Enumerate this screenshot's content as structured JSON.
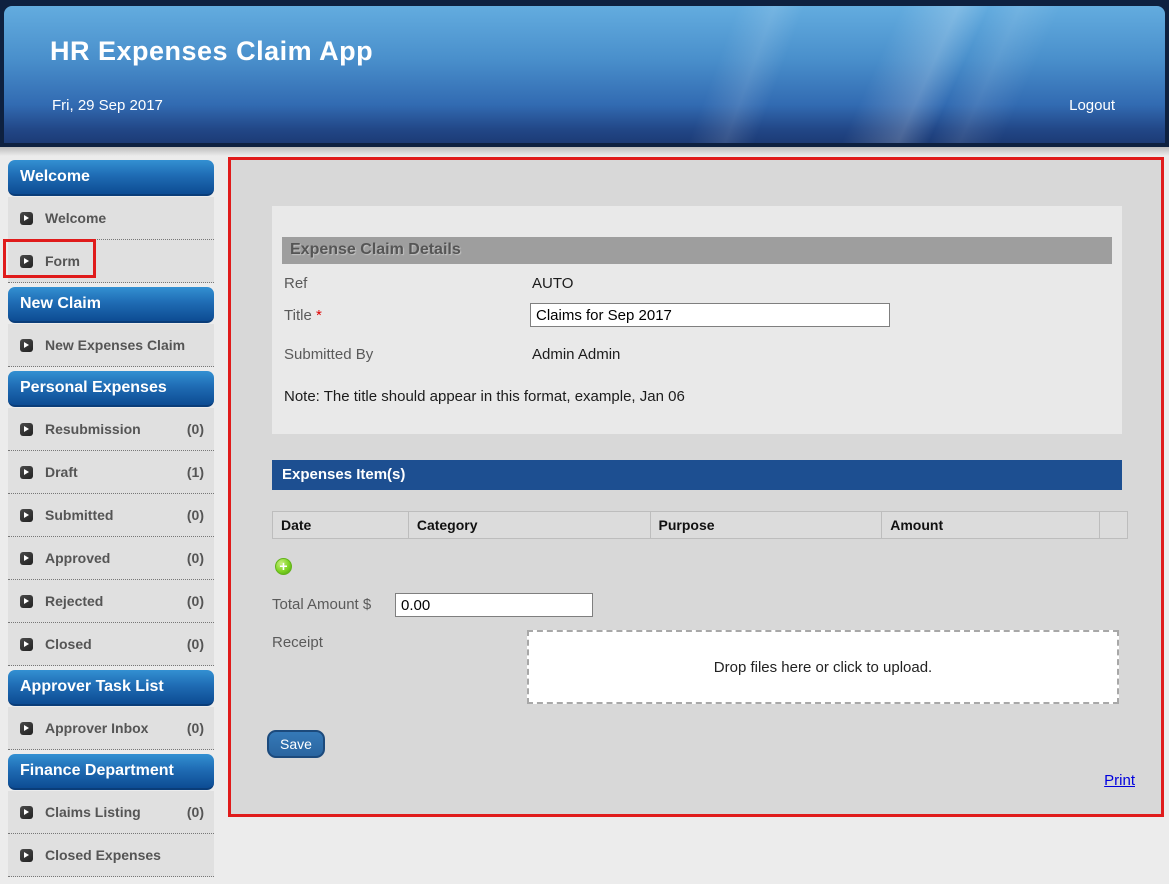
{
  "header": {
    "title": "HR Expenses Claim App",
    "date": "Fri, 29 Sep 2017",
    "logout_label": "Logout"
  },
  "sidebar": {
    "sections": [
      {
        "header": "Welcome",
        "items": [
          {
            "label": "Welcome",
            "count": ""
          },
          {
            "label": "Form",
            "count": "",
            "highlighted": true
          }
        ]
      },
      {
        "header": "New Claim",
        "items": [
          {
            "label": "New Expenses Claim",
            "count": ""
          }
        ]
      },
      {
        "header": "Personal Expenses",
        "items": [
          {
            "label": "Resubmission",
            "count": "(0)"
          },
          {
            "label": "Draft",
            "count": "(1)"
          },
          {
            "label": "Submitted",
            "count": "(0)"
          },
          {
            "label": "Approved",
            "count": "(0)"
          },
          {
            "label": "Rejected",
            "count": "(0)"
          },
          {
            "label": "Closed",
            "count": "(0)"
          }
        ]
      },
      {
        "header": "Approver Task List",
        "items": [
          {
            "label": "Approver Inbox",
            "count": "(0)"
          }
        ]
      },
      {
        "header": "Finance Department",
        "items": [
          {
            "label": "Claims Listing",
            "count": "(0)"
          },
          {
            "label": "Closed Expenses",
            "count": ""
          }
        ]
      }
    ]
  },
  "main": {
    "details": {
      "header": "Expense Claim Details",
      "ref_label": "Ref",
      "ref_value": "AUTO",
      "title_label": "Title",
      "required_marker": "*",
      "title_value": "Claims for Sep 2017",
      "submitted_by_label": "Submitted By",
      "submitted_by_value": "Admin Admin",
      "note": "Note: The title should appear in this format, example, Jan 06"
    },
    "items": {
      "header": "Expenses Item(s)",
      "columns": [
        "Date",
        "Category",
        "Purpose",
        "Amount"
      ],
      "add_icon": "plus-circle-icon",
      "add_glyph": "+",
      "total_label": "Total Amount $",
      "total_value": "0.00",
      "receipt_label": "Receipt",
      "dropzone_text": "Drop files here or click to upload."
    },
    "save_label": "Save",
    "print_label": "Print"
  },
  "colors": {
    "banner_navy": "#0e2140",
    "section_header_blue": "#0d4c93",
    "items_bar_blue": "#1d4f91",
    "annotation_red": "#e01b1b",
    "add_green": "#7ed321",
    "link_blue": "#0000dd"
  }
}
